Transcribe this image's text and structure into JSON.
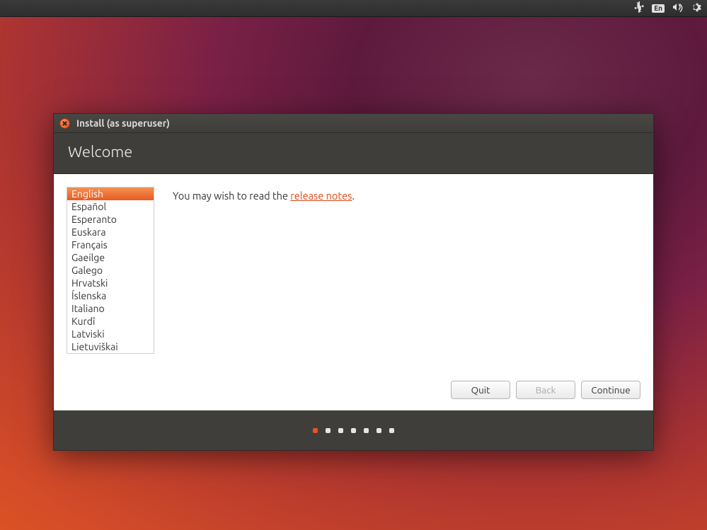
{
  "menubar": {
    "language_indicator": "En"
  },
  "window": {
    "title": "Install (as superuser)",
    "heading": "Welcome",
    "message_prefix": "You may wish to read the ",
    "link_text": "release notes",
    "message_suffix": ".",
    "buttons": {
      "quit": "Quit",
      "back": "Back",
      "continue": "Continue"
    }
  },
  "languages": [
    {
      "name": "English",
      "selected": true
    },
    {
      "name": "Español",
      "selected": false
    },
    {
      "name": "Esperanto",
      "selected": false
    },
    {
      "name": "Euskara",
      "selected": false
    },
    {
      "name": "Français",
      "selected": false
    },
    {
      "name": "Gaeilge",
      "selected": false
    },
    {
      "name": "Galego",
      "selected": false
    },
    {
      "name": "Hrvatski",
      "selected": false
    },
    {
      "name": "Íslenska",
      "selected": false
    },
    {
      "name": "Italiano",
      "selected": false
    },
    {
      "name": "Kurdî",
      "selected": false
    },
    {
      "name": "Latviski",
      "selected": false
    },
    {
      "name": "Lietuviškai",
      "selected": false
    }
  ],
  "progress": {
    "total_steps": 7,
    "current_step": 1
  },
  "colors": {
    "accent": "#e95420",
    "header_bg": "#3f3e3a"
  }
}
